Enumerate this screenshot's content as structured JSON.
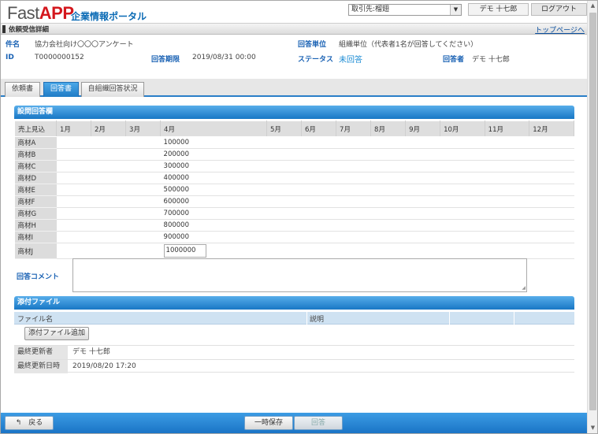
{
  "header": {
    "logo_fast": "Fast",
    "logo_app": "APP",
    "portal_title": "企業情報ポータル",
    "client_select_value": "取引先:榴翅",
    "user_name": "デモ 十七郎",
    "logout_label": "ログアウト"
  },
  "breadcrumb": {
    "page_title": "依頼受信詳細",
    "top_link": "トップページへ"
  },
  "request_info": {
    "subject_label": "件名",
    "subject_value": "協力会社向け〇〇〇アンケート",
    "answer_unit_label": "回答単位",
    "answer_unit_value": "組織単位（代表者1名が回答してください）",
    "id_label": "ID",
    "id_value": "T0000000152",
    "deadline_label": "回答期限",
    "deadline_value": "2019/08/31 00:00",
    "status_label": "ステータス",
    "status_value": "未回答",
    "respondent_label": "回答者",
    "respondent_value": "デモ 十七郎"
  },
  "tabs": [
    {
      "label": "依頼書"
    },
    {
      "label": "回答書"
    },
    {
      "label": "自組織回答状況"
    }
  ],
  "answer_section": {
    "title": "設問回答欄",
    "corner_header": "売上見込",
    "months": [
      "1月",
      "2月",
      "3月",
      "4月",
      "5月",
      "6月",
      "7月",
      "8月",
      "9月",
      "10月",
      "11月",
      "12月"
    ],
    "rows": [
      {
        "name": "商材A",
        "april": "100000"
      },
      {
        "name": "商材B",
        "april": "200000"
      },
      {
        "name": "商材C",
        "april": "300000"
      },
      {
        "name": "商材D",
        "april": "400000"
      },
      {
        "name": "商材E",
        "april": "500000"
      },
      {
        "name": "商材F",
        "april": "600000"
      },
      {
        "name": "商材G",
        "april": "700000"
      },
      {
        "name": "商材H",
        "april": "800000"
      },
      {
        "name": "商材I",
        "april": "900000"
      },
      {
        "name": "商材J",
        "april": "1000000"
      }
    ]
  },
  "comment": {
    "label": "回答コメント",
    "value": ""
  },
  "attachments": {
    "title": "添付ファイル",
    "col_file_name": "ファイル名",
    "col_description": "説明",
    "add_button": "添付ファイル追加"
  },
  "meta": {
    "last_updater_label": "最終更新者",
    "last_updater_value": "デモ 十七郎",
    "last_updated_label": "最終更新日時",
    "last_updated_value": "2019/08/20 17:20"
  },
  "footer": {
    "back_label": "戻る",
    "save_label": "一時保存",
    "submit_label": "回答"
  },
  "colors": {
    "accent_blue": "#1a77c6",
    "logo_red": "#d4171d",
    "label_blue": "#1a62b4"
  }
}
